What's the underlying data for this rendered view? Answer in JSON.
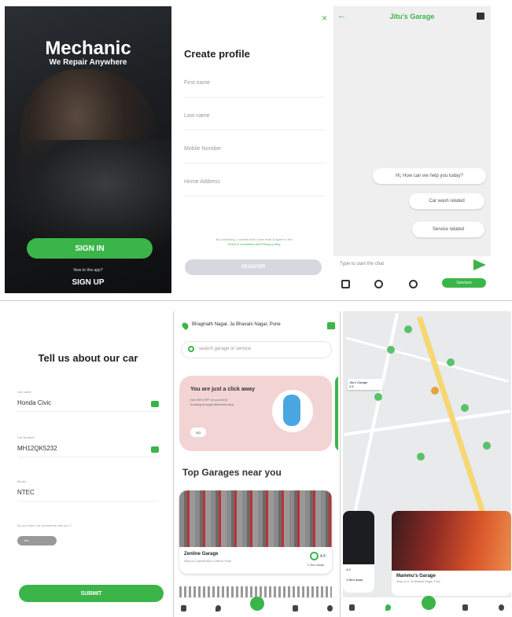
{
  "screen_welcome": {
    "brand": "Mechanic",
    "tagline": "We Repair Anywhere",
    "sign_in": "SIGN IN",
    "new_prompt": "New to this app?",
    "sign_up": "SIGN UP"
  },
  "screen_profile": {
    "close": "×",
    "title": "Create profile",
    "fields": [
      "First name",
      "Last name",
      "Mobile Number",
      "Home Address"
    ],
    "terms": "By continuing, I confirm that I have read & agree to the",
    "terms_link": "Terms & conditions and Privacy policy",
    "register": "REGISTER"
  },
  "screen_chat": {
    "back": "←",
    "title": "Jitu's Garage",
    "greeting": "Hi, How can we help you today?",
    "options": [
      "Car wash related",
      "Service related"
    ],
    "input_placeholder": "Type to start the chat",
    "services_label": "Services"
  },
  "screen_car": {
    "title": "Tell us about our car",
    "fields": [
      {
        "label": "Car name",
        "value": "Honda Civic"
      },
      {
        "label": "Car Number",
        "value": "MH12QK5232"
      },
      {
        "label": "Model",
        "value": "NTEC"
      }
    ],
    "question": "Do you have car documents with you ?",
    "select_value": "Yes",
    "submit": "SUBMIT"
  },
  "screen_home": {
    "location": "Bhaginath Nagar, Ja Bhavani Nagar, Pune",
    "search_placeholder": "search garage or service",
    "promo_title": "You are just a click away",
    "promo_desc": "Get 30% OFF on your first booking through Mechanic App",
    "promo_btn": "GO",
    "section_title": "Top Garages near you",
    "garage_name": "Zenline Garage",
    "garage_addr": "Shop no 3 ground floor, Kothrud, Pune",
    "garage_rating": "4.5",
    "garage_distance": "1.2km away"
  },
  "screen_map": {
    "marker_label": "Jitu's Garage",
    "marker_rating": "4.5",
    "card_a_rating": "4.5",
    "card_a_distance": "1.5km away",
    "card_b_title": "Mammu's Garage",
    "card_b_addr": "Shop no 5, Ja Bhavani Nagar, Pune"
  },
  "colors": {
    "accent": "#3bb54a",
    "promo_bg": "#f3d4d4"
  }
}
